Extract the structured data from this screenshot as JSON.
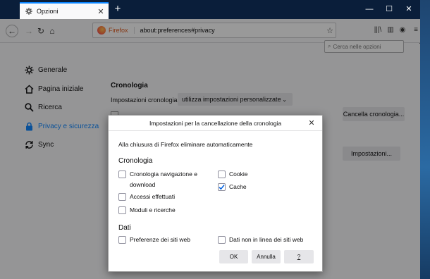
{
  "tab": {
    "title": "Opzioni",
    "close": "✕",
    "new_tab": "+"
  },
  "window_controls": {
    "minimize": "—",
    "maximize": "☐",
    "close": "✕"
  },
  "nav": {
    "back": "←",
    "forward": "→",
    "reload": "↻",
    "home": "⌂",
    "identity_label": "Firefox",
    "url": "about:preferences#privacy",
    "bookmark": "☆"
  },
  "toolbar": {
    "library": "|||\\",
    "sidebar": "▥",
    "account": "◉",
    "menu": "≡"
  },
  "search": {
    "placeholder": "Cerca nelle opzioni"
  },
  "sidebar": {
    "items": [
      {
        "label": "Generale",
        "icon": "gear-icon"
      },
      {
        "label": "Pagina iniziale",
        "icon": "home-icon"
      },
      {
        "label": "Ricerca",
        "icon": "search-icon"
      },
      {
        "label": "Privacy e sicurezza",
        "icon": "lock-icon",
        "active": true
      },
      {
        "label": "Sync",
        "icon": "sync-icon"
      }
    ]
  },
  "main": {
    "section_title": "Cronologia",
    "history_label": "Impostazioni cronologia:",
    "history_value": "utilizza impostazioni personalizzate",
    "clear_history_button": "Cancella cronologia...",
    "settings_button": "Impostazioni..."
  },
  "dialog": {
    "title": "Impostazioni per la cancellazione della cronologia",
    "close": "✕",
    "intro": "Alla chiusura di Firefox eliminare automaticamente",
    "history_heading": "Cronologia",
    "data_heading": "Dati",
    "checkboxes": {
      "browsing": {
        "label": "Cronologia navigazione e download",
        "checked": false
      },
      "logins": {
        "label": "Accessi effettuati",
        "checked": false
      },
      "forms": {
        "label": "Moduli e ricerche",
        "checked": false
      },
      "cookies": {
        "label": "Cookie",
        "checked": false
      },
      "cache": {
        "label": "Cache",
        "checked": true
      },
      "site_prefs": {
        "label": "Preferenze dei siti web",
        "checked": false
      },
      "offline_data": {
        "label": "Dati non in linea dei siti web",
        "checked": false
      }
    },
    "buttons": {
      "ok": "OK",
      "cancel": "Annulla",
      "help": "?"
    }
  },
  "colors": {
    "accent": "#0a84ff",
    "titlebar": "#0a1e3a",
    "check": "#0060df"
  }
}
